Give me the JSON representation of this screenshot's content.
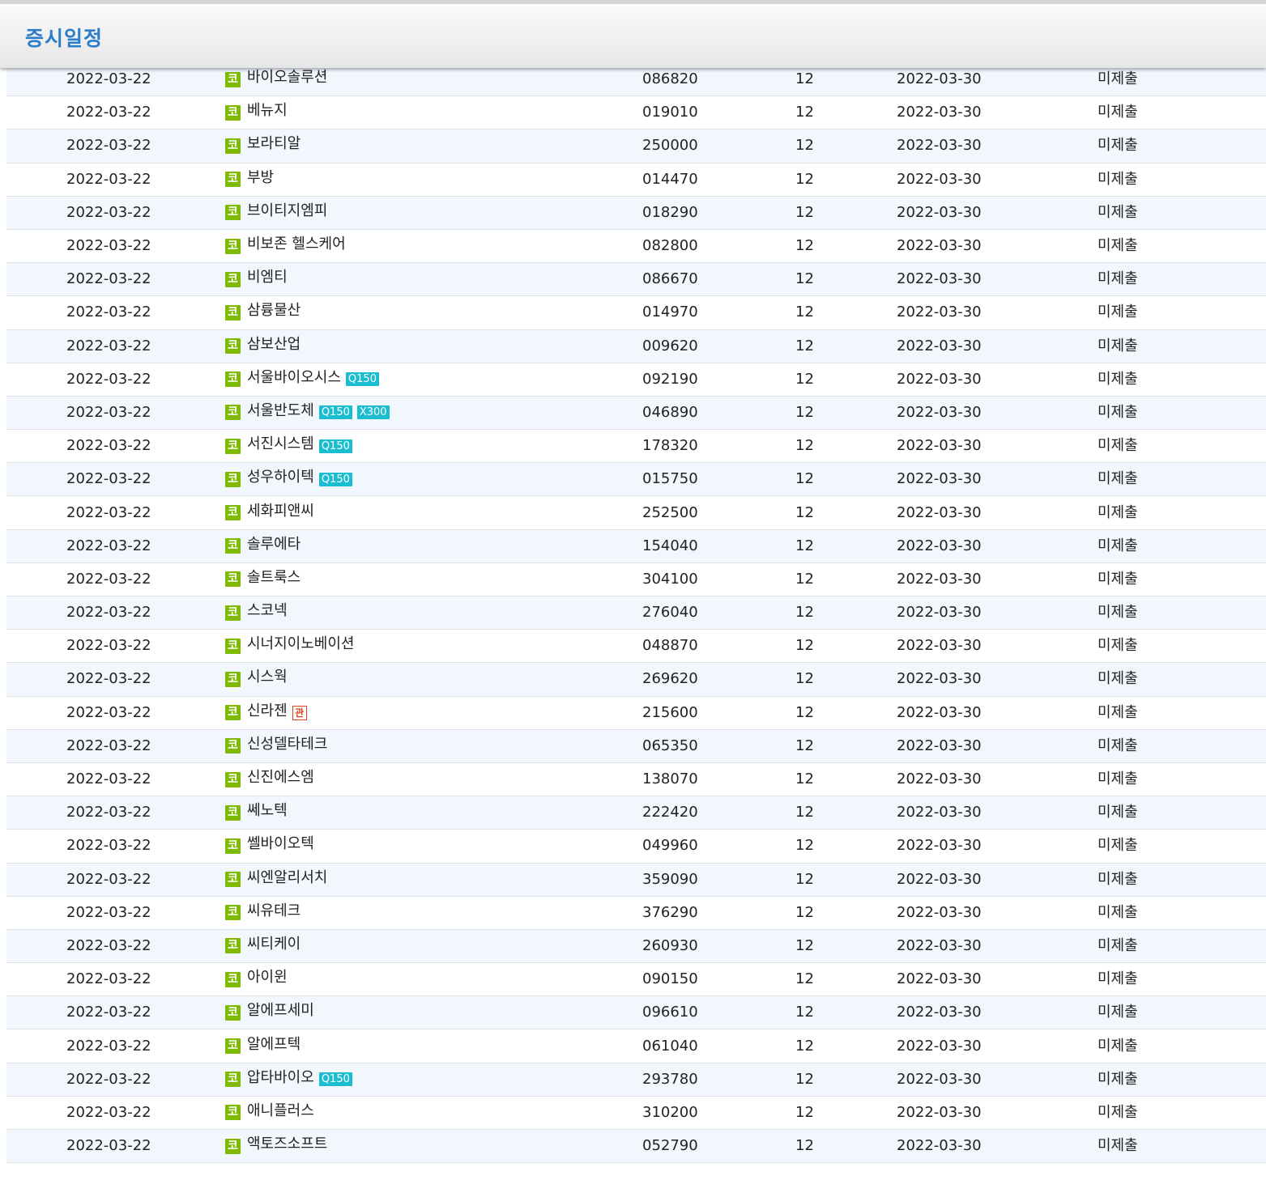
{
  "header": {
    "title": "증시일정"
  },
  "rows": [
    {
      "date": "2022-03-22",
      "name": "바이오솔루션",
      "code": "086820",
      "month": "12",
      "due": "2022-03-30",
      "status": "미제출",
      "tags": []
    },
    {
      "date": "2022-03-22",
      "name": "베뉴지",
      "code": "019010",
      "month": "12",
      "due": "2022-03-30",
      "status": "미제출",
      "tags": []
    },
    {
      "date": "2022-03-22",
      "name": "보라티알",
      "code": "250000",
      "month": "12",
      "due": "2022-03-30",
      "status": "미제출",
      "tags": []
    },
    {
      "date": "2022-03-22",
      "name": "부방",
      "code": "014470",
      "month": "12",
      "due": "2022-03-30",
      "status": "미제출",
      "tags": []
    },
    {
      "date": "2022-03-22",
      "name": "브이티지엠피",
      "code": "018290",
      "month": "12",
      "due": "2022-03-30",
      "status": "미제출",
      "tags": []
    },
    {
      "date": "2022-03-22",
      "name": "비보존 헬스케어",
      "code": "082800",
      "month": "12",
      "due": "2022-03-30",
      "status": "미제출",
      "tags": []
    },
    {
      "date": "2022-03-22",
      "name": "비엠티",
      "code": "086670",
      "month": "12",
      "due": "2022-03-30",
      "status": "미제출",
      "tags": []
    },
    {
      "date": "2022-03-22",
      "name": "삼륭물산",
      "code": "014970",
      "month": "12",
      "due": "2022-03-30",
      "status": "미제출",
      "tags": []
    },
    {
      "date": "2022-03-22",
      "name": "삼보산업",
      "code": "009620",
      "month": "12",
      "due": "2022-03-30",
      "status": "미제출",
      "tags": []
    },
    {
      "date": "2022-03-22",
      "name": "서울바이오시스",
      "code": "092190",
      "month": "12",
      "due": "2022-03-30",
      "status": "미제출",
      "tags": [
        "Q150"
      ]
    },
    {
      "date": "2022-03-22",
      "name": "서울반도체",
      "code": "046890",
      "month": "12",
      "due": "2022-03-30",
      "status": "미제출",
      "tags": [
        "Q150",
        "X300"
      ]
    },
    {
      "date": "2022-03-22",
      "name": "서진시스템",
      "code": "178320",
      "month": "12",
      "due": "2022-03-30",
      "status": "미제출",
      "tags": [
        "Q150"
      ]
    },
    {
      "date": "2022-03-22",
      "name": "성우하이텍",
      "code": "015750",
      "month": "12",
      "due": "2022-03-30",
      "status": "미제출",
      "tags": [
        "Q150"
      ]
    },
    {
      "date": "2022-03-22",
      "name": "세화피앤씨",
      "code": "252500",
      "month": "12",
      "due": "2022-03-30",
      "status": "미제출",
      "tags": []
    },
    {
      "date": "2022-03-22",
      "name": "솔루에타",
      "code": "154040",
      "month": "12",
      "due": "2022-03-30",
      "status": "미제출",
      "tags": []
    },
    {
      "date": "2022-03-22",
      "name": "솔트룩스",
      "code": "304100",
      "month": "12",
      "due": "2022-03-30",
      "status": "미제출",
      "tags": []
    },
    {
      "date": "2022-03-22",
      "name": "스코넥",
      "code": "276040",
      "month": "12",
      "due": "2022-03-30",
      "status": "미제출",
      "tags": []
    },
    {
      "date": "2022-03-22",
      "name": "시너지이노베이션",
      "code": "048870",
      "month": "12",
      "due": "2022-03-30",
      "status": "미제출",
      "tags": []
    },
    {
      "date": "2022-03-22",
      "name": "시스웍",
      "code": "269620",
      "month": "12",
      "due": "2022-03-30",
      "status": "미제출",
      "tags": []
    },
    {
      "date": "2022-03-22",
      "name": "신라젠",
      "code": "215600",
      "month": "12",
      "due": "2022-03-30",
      "status": "미제출",
      "tags": [],
      "mgmt": "관"
    },
    {
      "date": "2022-03-22",
      "name": "신성델타테크",
      "code": "065350",
      "month": "12",
      "due": "2022-03-30",
      "status": "미제출",
      "tags": []
    },
    {
      "date": "2022-03-22",
      "name": "신진에스엠",
      "code": "138070",
      "month": "12",
      "due": "2022-03-30",
      "status": "미제출",
      "tags": []
    },
    {
      "date": "2022-03-22",
      "name": "쎄노텍",
      "code": "222420",
      "month": "12",
      "due": "2022-03-30",
      "status": "미제출",
      "tags": []
    },
    {
      "date": "2022-03-22",
      "name": "쎌바이오텍",
      "code": "049960",
      "month": "12",
      "due": "2022-03-30",
      "status": "미제출",
      "tags": []
    },
    {
      "date": "2022-03-22",
      "name": "씨엔알리서치",
      "code": "359090",
      "month": "12",
      "due": "2022-03-30",
      "status": "미제출",
      "tags": []
    },
    {
      "date": "2022-03-22",
      "name": "씨유테크",
      "code": "376290",
      "month": "12",
      "due": "2022-03-30",
      "status": "미제출",
      "tags": []
    },
    {
      "date": "2022-03-22",
      "name": "씨티케이",
      "code": "260930",
      "month": "12",
      "due": "2022-03-30",
      "status": "미제출",
      "tags": []
    },
    {
      "date": "2022-03-22",
      "name": "아이윈",
      "code": "090150",
      "month": "12",
      "due": "2022-03-30",
      "status": "미제출",
      "tags": []
    },
    {
      "date": "2022-03-22",
      "name": "알에프세미",
      "code": "096610",
      "month": "12",
      "due": "2022-03-30",
      "status": "미제출",
      "tags": []
    },
    {
      "date": "2022-03-22",
      "name": "알에프텍",
      "code": "061040",
      "month": "12",
      "due": "2022-03-30",
      "status": "미제출",
      "tags": []
    },
    {
      "date": "2022-03-22",
      "name": "압타바이오",
      "code": "293780",
      "month": "12",
      "due": "2022-03-30",
      "status": "미제출",
      "tags": [
        "Q150"
      ]
    },
    {
      "date": "2022-03-22",
      "name": "애니플러스",
      "code": "310200",
      "month": "12",
      "due": "2022-03-30",
      "status": "미제출",
      "tags": []
    },
    {
      "date": "2022-03-22",
      "name": "액토즈소프트",
      "code": "052790",
      "month": "12",
      "due": "2022-03-30",
      "status": "미제출",
      "tags": []
    }
  ],
  "market_icon": {
    "glyph": "코",
    "color": "#7dba00",
    "name": "kosdaq-market-icon"
  },
  "colors": {
    "accent": "#2a7ec8",
    "tag": "#1bbdd0",
    "mgmt": "#e0431b",
    "row_alt": "#f1f7fd"
  }
}
